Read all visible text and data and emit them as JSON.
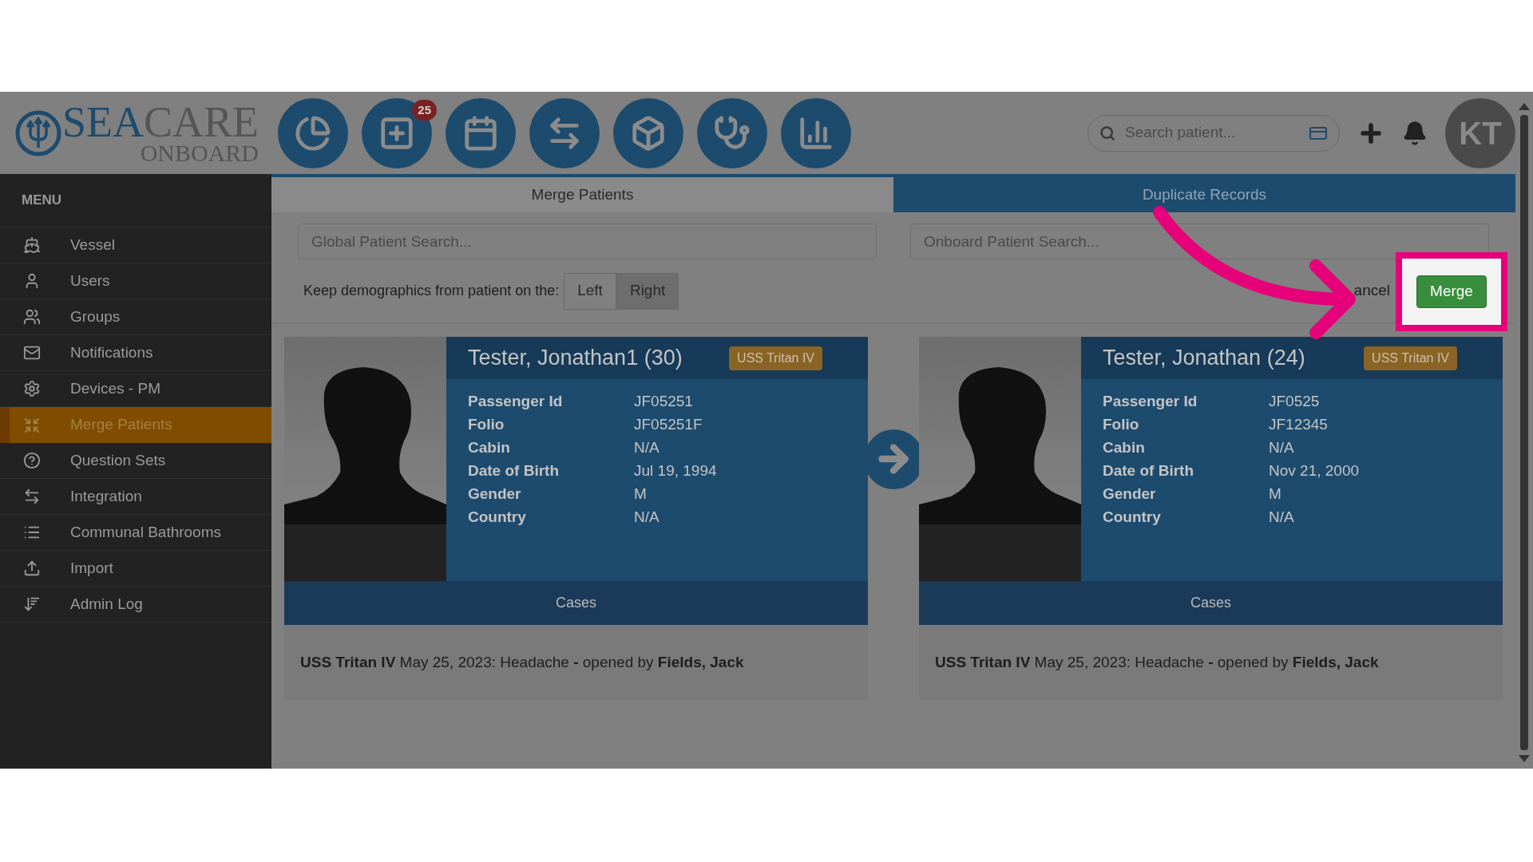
{
  "logo": {
    "primary": "SEA",
    "secondary": "CARE",
    "sub": "ONBOARD"
  },
  "toolbar": [
    {
      "kind": "dashboard"
    },
    {
      "kind": "cases",
      "badge": "25"
    },
    {
      "kind": "calendar"
    },
    {
      "kind": "transfer"
    },
    {
      "kind": "inventory"
    },
    {
      "kind": "medical"
    },
    {
      "kind": "reports"
    }
  ],
  "search": {
    "placeholder": "Search patient..."
  },
  "avatar": "KT",
  "menu": {
    "title": "MENU",
    "items": [
      {
        "label": "Vessel",
        "kind": "vessel",
        "selected": false
      },
      {
        "label": "Users",
        "kind": "user",
        "selected": false
      },
      {
        "label": "Groups",
        "kind": "group",
        "selected": false
      },
      {
        "label": "Notifications",
        "kind": "mail",
        "selected": false
      },
      {
        "label": "Devices - PM",
        "kind": "gears",
        "selected": false
      },
      {
        "label": "Merge Patients",
        "kind": "merge",
        "selected": true
      },
      {
        "label": "Question Sets",
        "kind": "question",
        "selected": false
      },
      {
        "label": "Integration",
        "kind": "exchange",
        "selected": false
      },
      {
        "label": "Communal Bathrooms",
        "kind": "list",
        "selected": false
      },
      {
        "label": "Import",
        "kind": "upload",
        "selected": false
      },
      {
        "label": "Admin Log",
        "kind": "sort",
        "selected": false
      }
    ]
  },
  "tabs": [
    {
      "label": "Merge Patients",
      "selected": true
    },
    {
      "label": "Duplicate Records",
      "selected": false
    }
  ],
  "global_search": {
    "placeholder": "Global Patient Search..."
  },
  "onboard_search": {
    "placeholder": "Onboard Patient Search..."
  },
  "keep": {
    "label": "Keep demographics from patient on the:",
    "options": [
      {
        "label": "Left",
        "selected": false
      },
      {
        "label": "Right",
        "selected": true
      }
    ]
  },
  "cancel": "ancel",
  "merge": "Merge",
  "patients": [
    {
      "name": "Tester, Jonathan1 (30)",
      "vessel": "USS Tritan IV",
      "fields": [
        {
          "label": "Passenger Id",
          "value": "JF05251"
        },
        {
          "label": "Folio",
          "value": "JF05251F"
        },
        {
          "label": "Cabin",
          "value": "N/A"
        },
        {
          "label": "Date of Birth",
          "value": "Jul 19, 1994"
        },
        {
          "label": "Gender",
          "value": "M"
        },
        {
          "label": "Country",
          "value": "N/A"
        }
      ],
      "cases_title": "Cases",
      "cases": [
        "**USS Tritan IV** May 25, 2023: Headache **-** opened by **Fields, Jack**"
      ]
    },
    {
      "name": "Tester, Jonathan (24)",
      "vessel": "USS Tritan IV",
      "fields": [
        {
          "label": "Passenger Id",
          "value": "JF0525"
        },
        {
          "label": "Folio",
          "value": "JF12345"
        },
        {
          "label": "Cabin",
          "value": "N/A"
        },
        {
          "label": "Date of Birth",
          "value": "Nov 21, 2000"
        },
        {
          "label": "Gender",
          "value": "M"
        },
        {
          "label": "Country",
          "value": "N/A"
        }
      ],
      "cases_title": "Cases",
      "cases": [
        "**USS Tritan IV** May 25, 2023: Headache **-** opened by **Fields, Jack**"
      ]
    }
  ]
}
